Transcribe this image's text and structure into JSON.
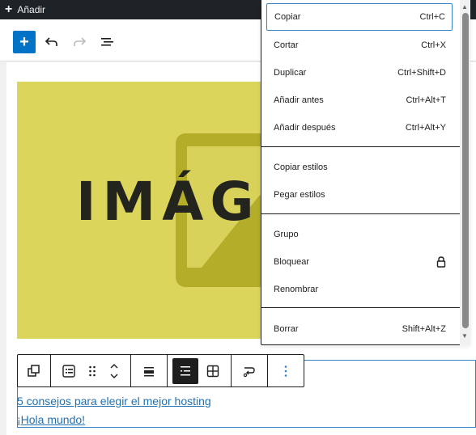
{
  "adminbar": {
    "add_label": "Añadir"
  },
  "toolbar": {
    "inserter_icon": "plus-icon",
    "undo_icon": "undo-icon",
    "redo_icon": "redo-icon",
    "outline_icon": "list-view-icon"
  },
  "image": {
    "text": "IMÁG",
    "bg_color": "#dbd55c"
  },
  "list": {
    "items": [
      "5 consejos para elegir el mejor hosting",
      "¡Hola mundo!"
    ]
  },
  "block_toolbar": {
    "icons": [
      "parent-select-icon",
      "list-icon",
      "drag-handle-icon",
      "move-up-down-icon",
      "align-icon",
      "list-indent-icon",
      "table-grid-icon",
      "transform-icon",
      "more-options-icon"
    ]
  },
  "menu": {
    "items": [
      {
        "label": "Copiar",
        "shortcut": "Ctrl+C"
      },
      {
        "label": "Cortar",
        "shortcut": "Ctrl+X"
      },
      {
        "label": "Duplicar",
        "shortcut": "Ctrl+Shift+D"
      },
      {
        "label": "Añadir antes",
        "shortcut": "Ctrl+Alt+T"
      },
      {
        "label": "Añadir después",
        "shortcut": "Ctrl+Alt+Y"
      },
      {
        "label": "Copiar estilos",
        "shortcut": ""
      },
      {
        "label": "Pegar estilos",
        "shortcut": ""
      },
      {
        "label": "Grupo",
        "shortcut": ""
      },
      {
        "label": "Bloquear",
        "shortcut": ""
      },
      {
        "label": "Renombrar",
        "shortcut": ""
      },
      {
        "label": "Borrar",
        "shortcut": "Shift+Alt+Z"
      }
    ]
  },
  "colors": {
    "accent": "#3582c4",
    "primary": "#0073c6",
    "link": "#2271b1"
  }
}
